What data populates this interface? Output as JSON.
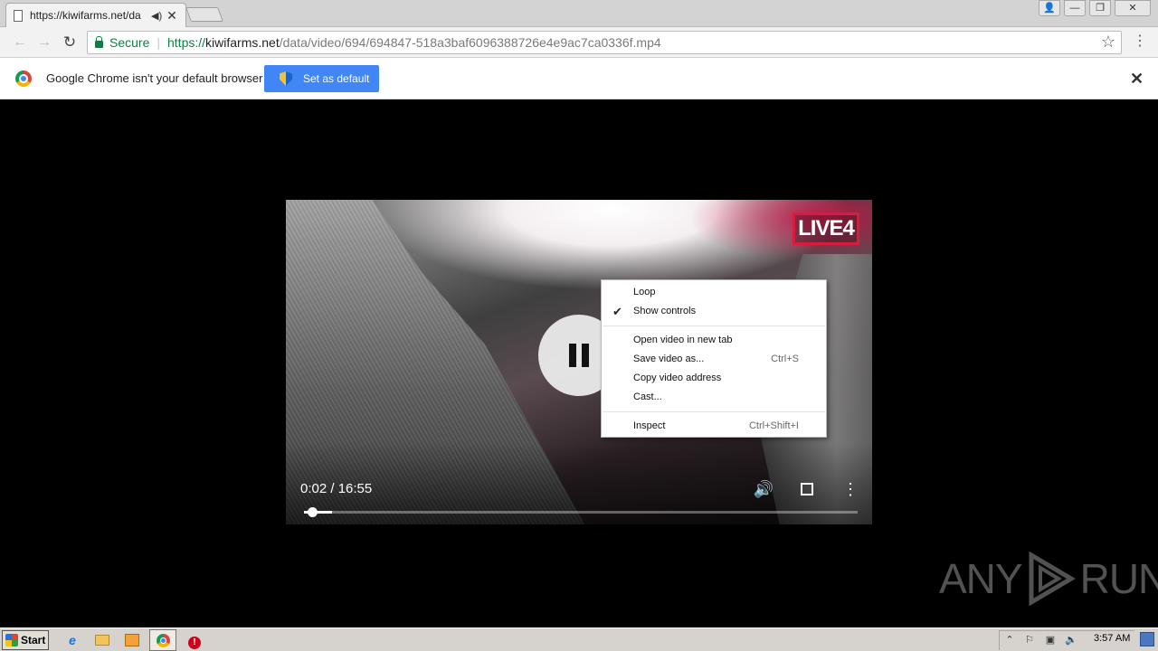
{
  "tab": {
    "title": "https://kiwifarms.net/da",
    "audio_icon": "speaker-icon",
    "close_icon": "close-icon"
  },
  "window_controls": {
    "user": "👤",
    "minimize": "—",
    "restore": "❐",
    "close": "✕"
  },
  "toolbar": {
    "back": "←",
    "forward": "→",
    "reload": "↻",
    "security_label": "Secure",
    "url_scheme": "https://",
    "url_host": "kiwifarms.net",
    "url_path": "/data/video/694/694847-518a3baf6096388726e4e9ac7ca0336f.mp4",
    "star": "☆",
    "menu": "⋮"
  },
  "infobar": {
    "message": "Google Chrome isn't your default browser",
    "set_default_label": "Set as default",
    "close": "✕"
  },
  "video": {
    "logo_text": "LIVE4",
    "time_display": "0:02 / 16:55",
    "progress": 0.05,
    "buffered": 0.05,
    "volume": "🔊",
    "more": "⋮"
  },
  "context_menu": {
    "items": [
      {
        "label": "Loop",
        "checked": false,
        "shortcut": ""
      },
      {
        "label": "Show controls",
        "checked": true,
        "shortcut": ""
      },
      {
        "label": "Open video in new tab",
        "shortcut": ""
      },
      {
        "label": "Save video as...",
        "shortcut": "Ctrl+S"
      },
      {
        "label": "Copy video address",
        "shortcut": ""
      },
      {
        "label": "Cast...",
        "shortcut": ""
      },
      {
        "label": "Inspect",
        "shortcut": "Ctrl+Shift+I"
      }
    ],
    "check_mark": "✔"
  },
  "watermark": {
    "left": "ANY",
    "right": "RUN"
  },
  "taskbar": {
    "start_label": "Start",
    "ie_glyph": "e",
    "stop_glyph": "!",
    "clock": "3:57 AM",
    "tray": {
      "arrow": "⌃",
      "flag": "⚐",
      "network": "▣",
      "volume": "🔈"
    }
  }
}
